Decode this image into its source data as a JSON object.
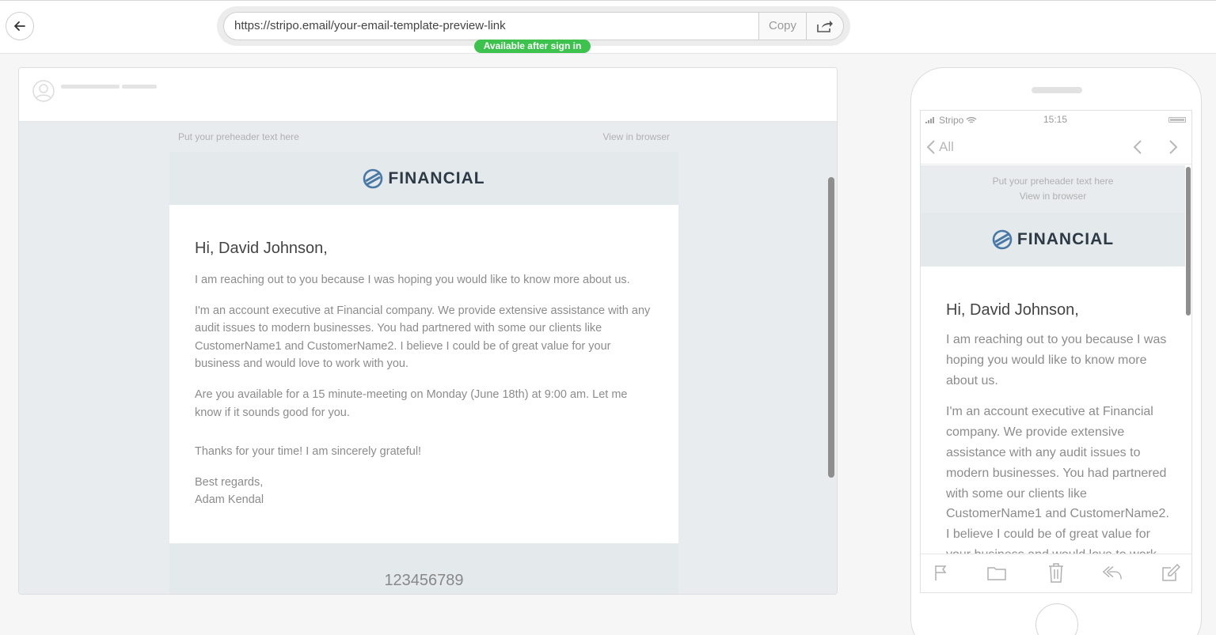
{
  "topbar": {
    "url": "https://stripo.email/your-email-template-preview-link",
    "copy_label": "Copy",
    "signin_badge": "Available after sign in"
  },
  "email": {
    "preheader": "Put your preheader text here",
    "view_in_browser": "View in browser",
    "brand": "FINANCIAL",
    "greeting": "Hi, David Johnson,",
    "paragraphs": [
      "I am reaching out to you because I was hoping you would like to know more about us.",
      "I'm an account executive at Financial company. We provide extensive assistance with any audit issues to modern businesses. You had partnered with some our clients like CustomerName1 and CustomerName2. I believe I could be of great value for your business and would love to work with you.",
      "Are you available for a 15 minute-meeting on Monday (June 18th) at 9:00 am. Let me know if it sounds good for you.",
      "Thanks for your time! I am sincerely grateful!"
    ],
    "sign_off": "Best regards,",
    "sender": "Adam Kendal",
    "footer_number": "123456789"
  },
  "mobile": {
    "carrier": "Stripo",
    "time": "15:15",
    "back_label": "All"
  },
  "colors": {
    "badge_green": "#3cc24d",
    "logo_dark": "#2d3a46",
    "logo_blue": "#4a78a6"
  }
}
